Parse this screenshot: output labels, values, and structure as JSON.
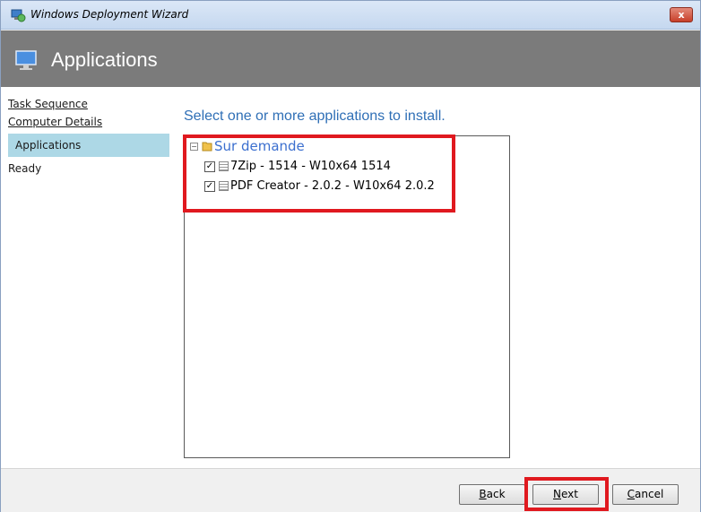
{
  "window": {
    "title": "Windows Deployment Wizard",
    "close_label": "x"
  },
  "banner": {
    "title": "Applications"
  },
  "sidebar": {
    "items": [
      {
        "label": "Task Sequence"
      },
      {
        "label": "Computer Details"
      },
      {
        "label": "Applications"
      },
      {
        "label": "Ready"
      }
    ]
  },
  "main": {
    "heading": "Select one or more applications to install.",
    "tree": {
      "root": {
        "label": "Sur demande",
        "expander": "⊟"
      },
      "items": [
        {
          "label": "7Zip - 1514 - W10x64 1514",
          "checked": "✓"
        },
        {
          "label": "PDF Creator - 2.0.2 - W10x64 2.0.2",
          "checked": "✓"
        }
      ]
    }
  },
  "footer": {
    "back": {
      "first": "B",
      "rest": "ack"
    },
    "next": {
      "first": "N",
      "rest": "ext"
    },
    "cancel": {
      "first": "C",
      "rest": "ancel"
    }
  },
  "colors": {
    "accent": "#2f6fb6",
    "highlight": "#e0191f",
    "banner": "#7b7b7b",
    "active_nav": "#add8e6"
  }
}
